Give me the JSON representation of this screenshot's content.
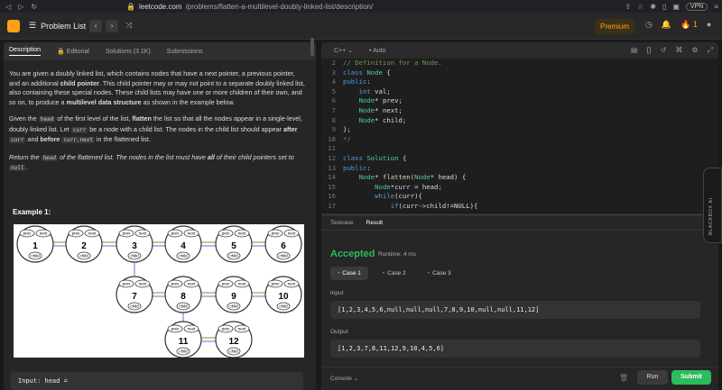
{
  "browser": {
    "url_host": "leetcode.com",
    "url_path": "/problems/flatten-a-multilevel-doubly-linked-list/description/",
    "vpn": "VPN"
  },
  "topnav": {
    "problem_list": "Problem List",
    "premium": "Premium",
    "streak": "1"
  },
  "tabs": [
    "Description",
    "Editorial",
    "Solutions (3.1K)",
    "Submissions"
  ],
  "description": {
    "p1_a": "You are given a doubly linked list, which contains nodes that have a next pointer, a previous pointer, and an additional ",
    "p1_b": "child pointer",
    "p1_c": ". This child pointer may or may not point to a separate doubly linked list, also containing these special nodes. These child lists may have one or more children of their own, and so on, to produce a ",
    "p1_d": "multilevel data structure",
    "p1_e": " as shown in the example below.",
    "p2_a": "Given the ",
    "p2_code1": "head",
    "p2_b": " of the first level of the list, ",
    "p2_c": "flatten",
    "p2_d": " the list so that all the nodes appear in a single-level, doubly linked list. Let ",
    "p2_code2": "curr",
    "p2_e": " be a node with a child list. The nodes in the child list should appear ",
    "p2_f": "after",
    "p2_code3": "curr",
    "p2_g": " and ",
    "p2_h": "before",
    "p2_code4": "curr.next",
    "p2_i": " in the flattened list.",
    "p3_a": "Return the ",
    "p3_code1": "head",
    "p3_b": " of the flattened list. The nodes in the list must have ",
    "p3_c": "all",
    "p3_d": " of their child pointers set to ",
    "p3_code2": "null",
    "p3_e": "."
  },
  "example_title": "Example 1:",
  "diagram": {
    "labels": {
      "prev": "prev",
      "next": "next",
      "child": "child"
    },
    "level1": [
      "1",
      "2",
      "3",
      "4",
      "5",
      "6"
    ],
    "level2": [
      "7",
      "8",
      "9",
      "10"
    ],
    "level3": [
      "11",
      "12"
    ]
  },
  "input_preview": "Input: head = ",
  "editor": {
    "language": "C++",
    "mode": "Auto",
    "lines": [
      {
        "n": "2",
        "html": "<span class='cm'>// Definition for a Node.</span>"
      },
      {
        "n": "3",
        "html": "<span class='kw'>class</span> <span class='ty'>Node</span> <span class='pl'>{</span>"
      },
      {
        "n": "4",
        "html": "<span class='kw'>public</span><span class='pl'>:</span>"
      },
      {
        "n": "5",
        "html": "    <span class='kw'>int</span> <span class='pl'>val;</span>"
      },
      {
        "n": "6",
        "html": "    <span class='ty'>Node</span><span class='pl'>* prev;</span>"
      },
      {
        "n": "7",
        "html": "    <span class='ty'>Node</span><span class='pl'>* next;</span>"
      },
      {
        "n": "8",
        "html": "    <span class='ty'>Node</span><span class='pl'>* child;</span>"
      },
      {
        "n": "9",
        "html": "<span class='pl'>};</span>"
      },
      {
        "n": "10",
        "html": "<span class='cm'>*/</span>"
      },
      {
        "n": "11",
        "html": ""
      },
      {
        "n": "12",
        "html": "<span class='kw'>class</span> <span class='ty'>Solution</span> <span class='pl'>{</span>"
      },
      {
        "n": "13",
        "html": "<span class='kw'>public</span><span class='pl'>:</span>"
      },
      {
        "n": "14",
        "html": "    <span class='ty'>Node</span><span class='pl'>* </span><span class='fn'>flatten</span><span class='pl'>(</span><span class='ty'>Node</span><span class='pl'>* head) {</span>"
      },
      {
        "n": "15",
        "html": "        <span class='ty'>Node</span><span class='pl'>*curr = head;</span>"
      },
      {
        "n": "16",
        "html": "        <span class='kw'>while</span><span class='pl'>(curr){</span>"
      },
      {
        "n": "17",
        "html": "            <span class='kw'>if</span><span class='pl'>(curr-&gt;child!=NULL){</span>"
      }
    ]
  },
  "result": {
    "tabs": [
      "Testcase",
      "Result"
    ],
    "status": "Accepted",
    "runtime": "Runtime: 4 ms",
    "cases": [
      "Case 1",
      "Case 2",
      "Case 3"
    ],
    "input_label": "Input",
    "input_value": "[1,2,3,4,5,6,null,null,null,7,8,9,10,null,null,11,12]",
    "output_label": "Output",
    "output_value": "[1,2,3,7,8,11,12,9,10,4,5,6]"
  },
  "bottom": {
    "console": "Console",
    "run": "Run",
    "submit": "Submit"
  },
  "blackbox": "BLACKBOX AI"
}
